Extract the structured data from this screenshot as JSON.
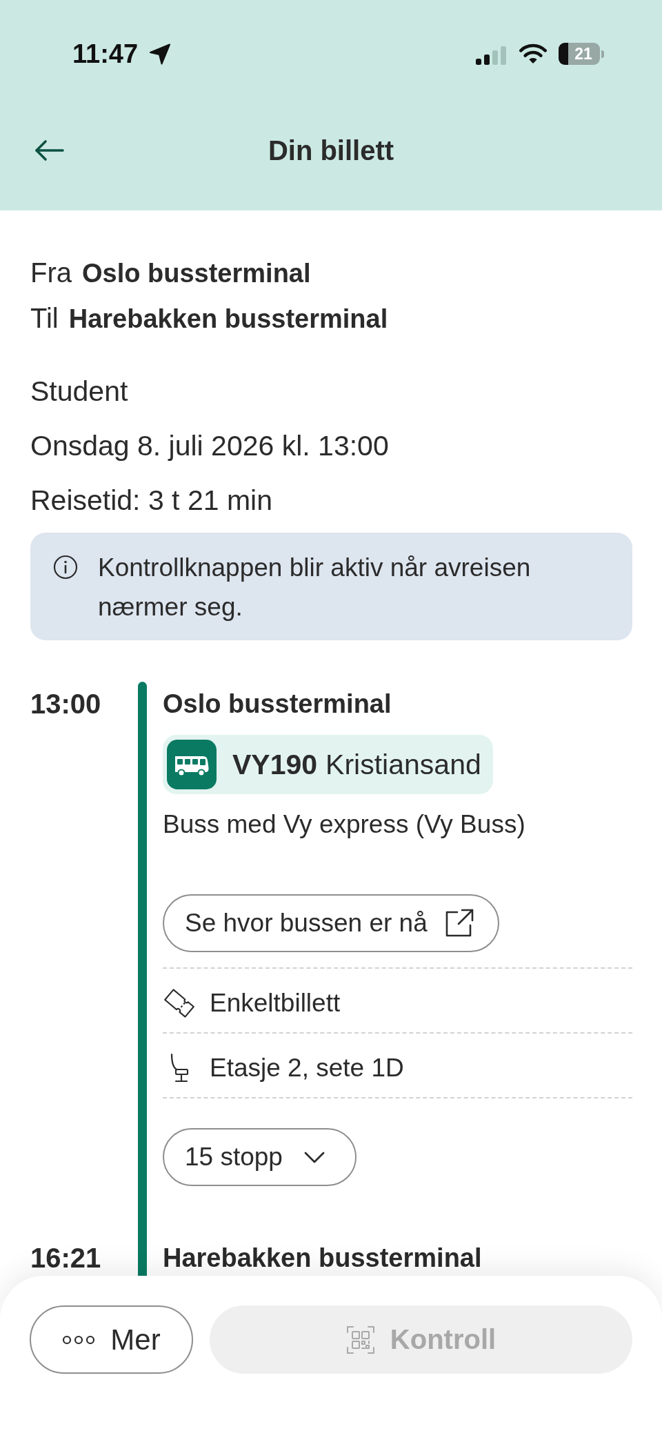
{
  "status_bar": {
    "time": "11:47",
    "battery": "21"
  },
  "header": {
    "title": "Din billett"
  },
  "route": [
    {
      "label": "Fra",
      "stop": "Oslo bussterminal"
    },
    {
      "label": "Til",
      "stop": "Harebakken bussterminal"
    }
  ],
  "details": [
    "Student",
    "Onsdag 8. juli 2026 kl. 13:00",
    "Reisetid: 3 t 21 min"
  ],
  "notice": {
    "text": "Kontrollknappen blir aktiv når avreisen nærmer seg."
  },
  "journey": {
    "departure": {
      "time": "13:00",
      "stop": "Oslo bussterminal"
    },
    "line": {
      "code": "VY190",
      "destination": "Kristiansand"
    },
    "operator": "Buss med Vy express (Vy Buss)",
    "live_button": {
      "label": "Se hvor bussen er nå"
    },
    "info_rows": [
      {
        "kind": "ticket",
        "text": "Enkeltbillett"
      },
      {
        "kind": "seat",
        "text": "Etasje 2, sete 1D"
      }
    ],
    "stops_button": {
      "label": "15 stopp",
      "expanded": false
    },
    "arrival": {
      "time": "16:21",
      "stop": "Harebakken bussterminal"
    }
  },
  "actions": [
    {
      "kind": "more",
      "label": "Mer",
      "disabled": false
    },
    {
      "kind": "control",
      "label": "Kontroll",
      "disabled": true
    }
  ]
}
